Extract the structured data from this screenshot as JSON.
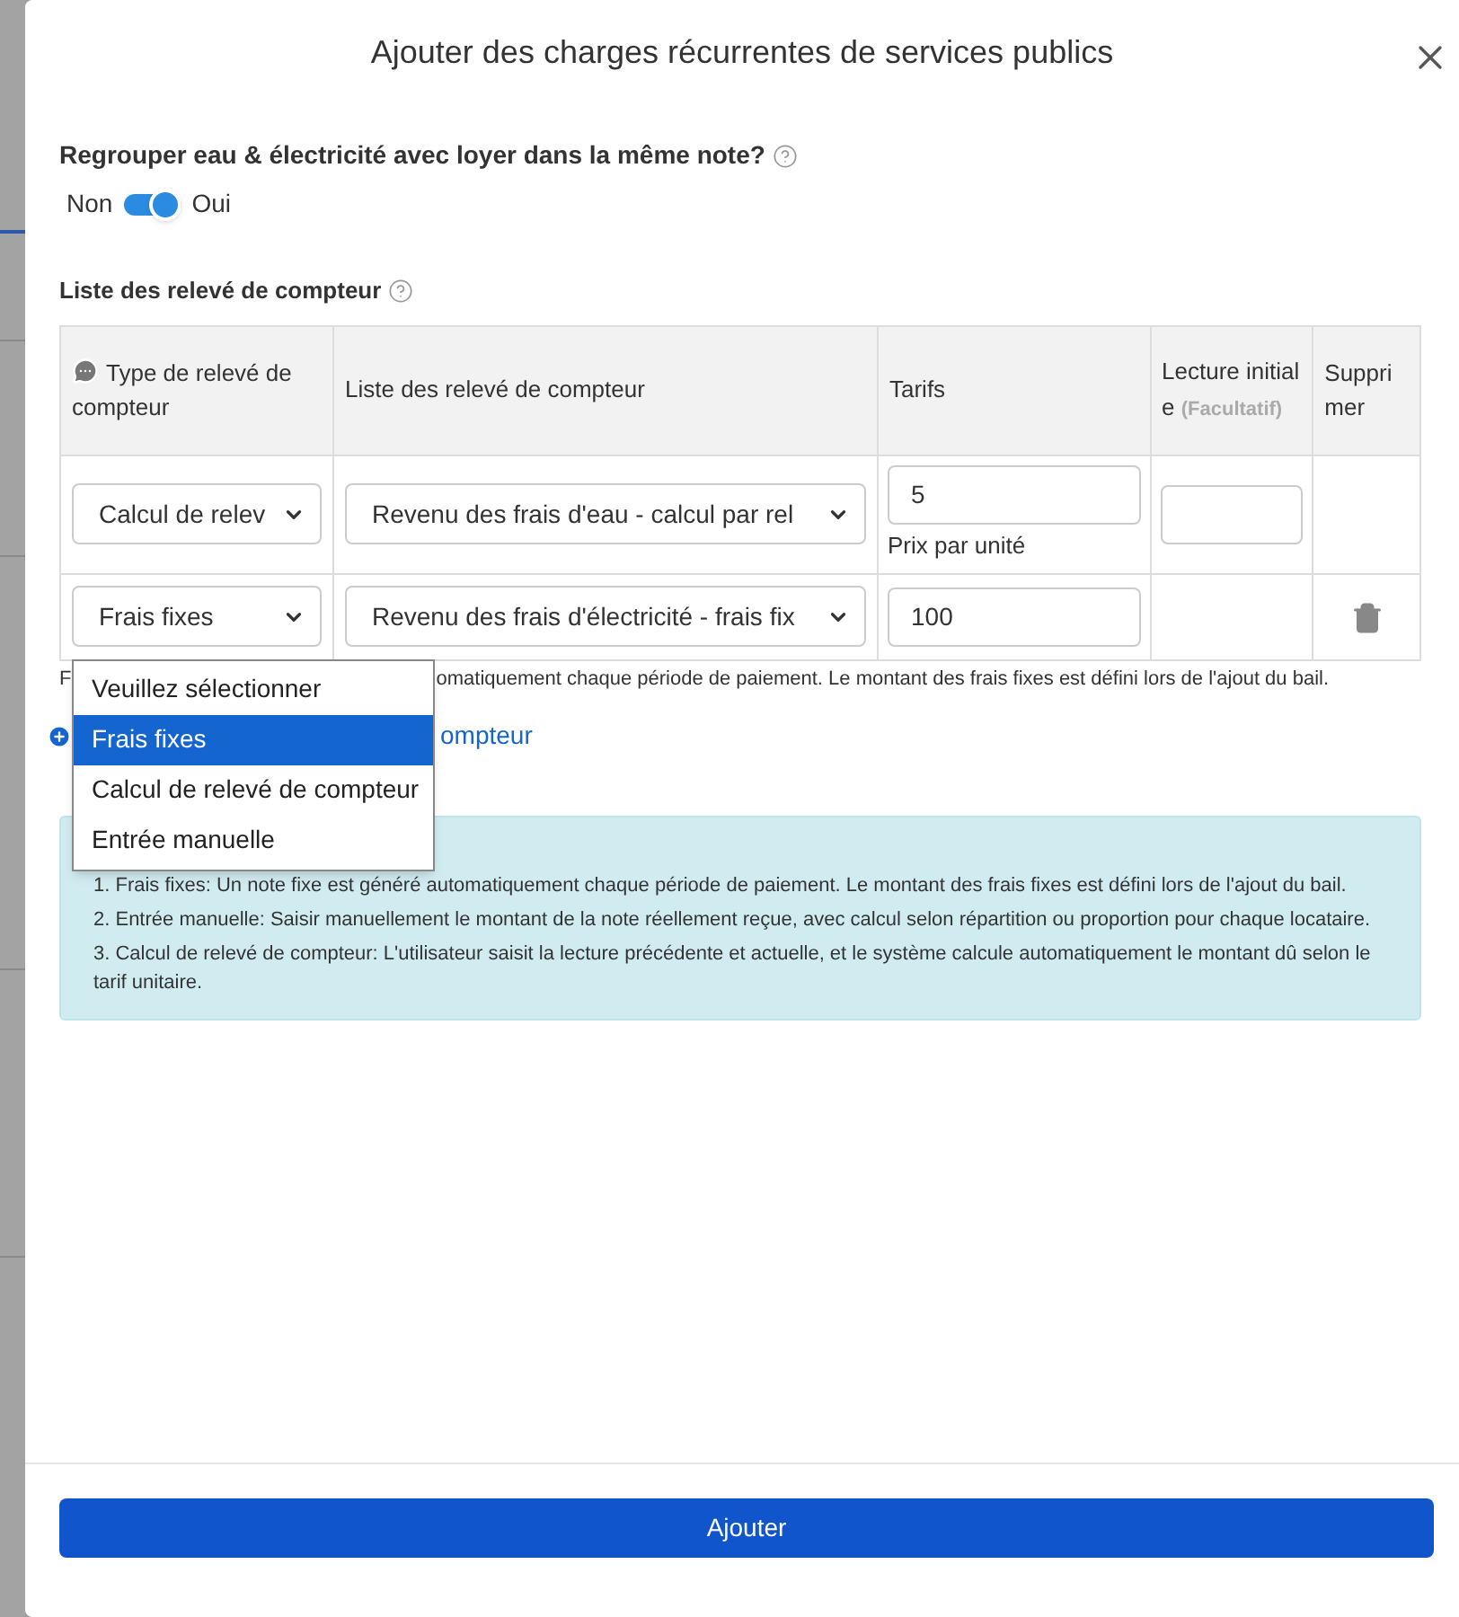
{
  "dialog": {
    "title": "Ajouter des charges récurrentes de services publics"
  },
  "group_question": {
    "label": "Regrouper eau & électricité avec loyer dans la même note?",
    "off_label": "Non",
    "on_label": "Oui",
    "on": true
  },
  "meter_list": {
    "label": "Liste des relevé de compteur",
    "columns": [
      {
        "label": "Type de relevé de compteur",
        "kind": "icon"
      },
      {
        "label": "Liste des relevé de compteur",
        "kind": "plain"
      },
      {
        "label": "Tarifs",
        "kind": "plain"
      },
      {
        "label": "Lecture initiale",
        "optional": "(Facultatif)",
        "kind": "optional"
      },
      {
        "label": "Supprimer",
        "kind": "plain"
      }
    ],
    "rows": [
      {
        "kind": "meter_reading",
        "type": "Calcul de relev",
        "meter": "Revenu des frais d'eau - calcul par rel",
        "rate": "5",
        "rate_hint": "Prix par unité"
      },
      {
        "kind": "fixed",
        "type": "Frais fixes",
        "meter": "Revenu des frais d'électricité - frais fix",
        "rate": "100",
        "dropdown_open": true
      }
    ]
  },
  "type_dropdown": {
    "options": [
      {
        "label": "Veuillez sélectionner",
        "selected": false
      },
      {
        "label": "Frais fixes",
        "selected": true
      },
      {
        "label": "Calcul de relevé de compteur",
        "selected": false
      },
      {
        "label": "Entrée manuelle",
        "selected": false
      }
    ]
  },
  "hint_fragments": [
    "F",
    "omatiquement chaque période de paiement. Le montant des frais fixes est défini lors de l'ajout du bail."
  ],
  "add_link": {
    "label": "ompteur"
  },
  "notes": [
    "1. Frais fixes: Un note fixe est généré automatiquement chaque période de paiement. Le montant des frais fixes est défini lors de l'ajout du bail.",
    "2. Entrée manuelle: Saisir manuellement le montant de la note réellement reçue, avec calcul selon répartition ou proportion pour chaque locataire.",
    "3. Calcul de relevé de compteur: L'utilisateur saisit la lecture précédente et actuelle, et le système calcule automatiquement le montant dû selon le tarif unitaire."
  ],
  "submit": {
    "label": "Ajouter"
  }
}
